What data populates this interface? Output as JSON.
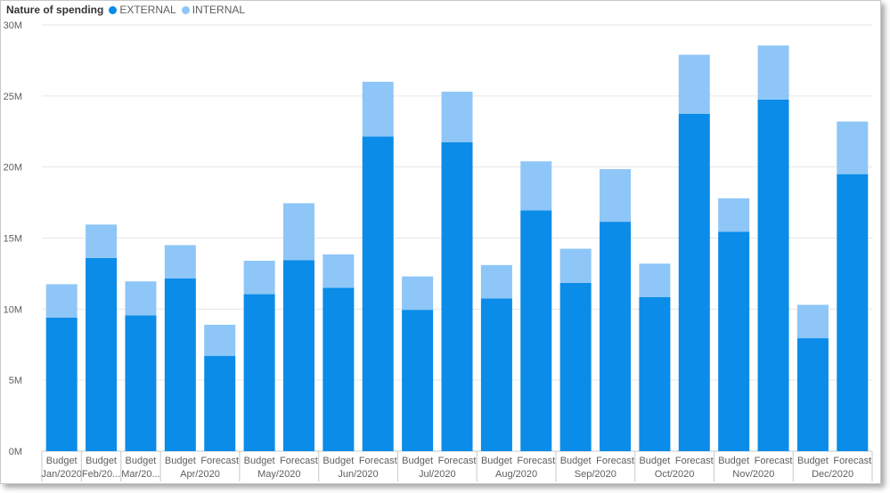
{
  "legend": {
    "title": "Nature of spending",
    "entries": [
      {
        "name": "EXTERNAL",
        "color": "#0a8ce8"
      },
      {
        "name": "INTERNAL",
        "color": "#8ec6f7"
      }
    ]
  },
  "chart_data": {
    "type": "bar",
    "stacked": true,
    "grid": true,
    "legend_position": "top-left",
    "y_ticks": [
      "0M",
      "5M",
      "10M",
      "15M",
      "20M",
      "25M",
      "30M"
    ],
    "ylim": [
      0,
      30
    ],
    "bars": [
      {
        "label": "Budget",
        "group": "Jan/2020",
        "external": 9.4,
        "internal": 2.35
      },
      {
        "label": "Budget",
        "group": "Feb/20...",
        "external": 13.6,
        "internal": 2.35
      },
      {
        "label": "Budget",
        "group": "Mar/20...",
        "external": 9.55,
        "internal": 2.4
      },
      {
        "label": "Budget",
        "group": "Apr/2020",
        "external": 12.15,
        "internal": 2.35
      },
      {
        "label": "Forecast",
        "group": "Apr/2020",
        "external": 6.7,
        "internal": 2.2
      },
      {
        "label": "Budget",
        "group": "May/2020",
        "external": 11.05,
        "internal": 2.35
      },
      {
        "label": "Forecast",
        "group": "May/2020",
        "external": 13.45,
        "internal": 4.0
      },
      {
        "label": "Budget",
        "group": "Jun/2020",
        "external": 11.5,
        "internal": 2.35
      },
      {
        "label": "Forecast",
        "group": "Jun/2020",
        "external": 22.15,
        "internal": 3.85
      },
      {
        "label": "Budget",
        "group": "Jul/2020",
        "external": 9.95,
        "internal": 2.35
      },
      {
        "label": "Forecast",
        "group": "Jul/2020",
        "external": 21.75,
        "internal": 3.55
      },
      {
        "label": "Budget",
        "group": "Aug/2020",
        "external": 10.75,
        "internal": 2.35
      },
      {
        "label": "Forecast",
        "group": "Aug/2020",
        "external": 16.95,
        "internal": 3.45
      },
      {
        "label": "Budget",
        "group": "Sep/2020",
        "external": 11.85,
        "internal": 2.4
      },
      {
        "label": "Forecast",
        "group": "Sep/2020",
        "external": 16.15,
        "internal": 3.7
      },
      {
        "label": "Budget",
        "group": "Oct/2020",
        "external": 10.85,
        "internal": 2.35
      },
      {
        "label": "Forecast",
        "group": "Oct/2020",
        "external": 23.75,
        "internal": 4.15
      },
      {
        "label": "Budget",
        "group": "Nov/2020",
        "external": 15.45,
        "internal": 2.35
      },
      {
        "label": "Forecast",
        "group": "Nov/2020",
        "external": 24.75,
        "internal": 3.8
      },
      {
        "label": "Budget",
        "group": "Dec/2020",
        "external": 7.95,
        "internal": 2.35
      },
      {
        "label": "Forecast",
        "group": "Dec/2020",
        "external": 19.5,
        "internal": 3.7
      }
    ],
    "groups": [
      {
        "name": "Jan/2020",
        "count": 1
      },
      {
        "name": "Feb/20...",
        "count": 1
      },
      {
        "name": "Mar/20...",
        "count": 1
      },
      {
        "name": "Apr/2020",
        "count": 2
      },
      {
        "name": "May/2020",
        "count": 2
      },
      {
        "name": "Jun/2020",
        "count": 2
      },
      {
        "name": "Jul/2020",
        "count": 2
      },
      {
        "name": "Aug/2020",
        "count": 2
      },
      {
        "name": "Sep/2020",
        "count": 2
      },
      {
        "name": "Oct/2020",
        "count": 2
      },
      {
        "name": "Nov/2020",
        "count": 2
      },
      {
        "name": "Dec/2020",
        "count": 2
      }
    ]
  }
}
